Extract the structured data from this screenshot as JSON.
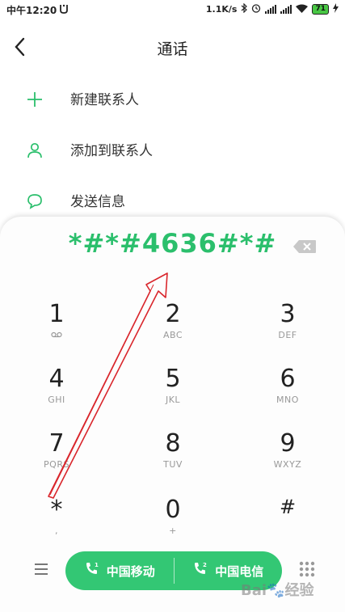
{
  "status_bar": {
    "time": "中午12:20",
    "net_speed": "1.1K/s",
    "battery": "71"
  },
  "header": {
    "title": "通话"
  },
  "menu": [
    {
      "label": "新建联系人",
      "icon": "plus-icon"
    },
    {
      "label": "添加到联系人",
      "icon": "person-icon"
    },
    {
      "label": "发送信息",
      "icon": "message-icon"
    }
  ],
  "dialer": {
    "number": "*#*#4636#*#",
    "keys": [
      {
        "digit": "1",
        "letters": "",
        "sub_icon": "voicemail-icon"
      },
      {
        "digit": "2",
        "letters": "ABC"
      },
      {
        "digit": "3",
        "letters": "DEF"
      },
      {
        "digit": "4",
        "letters": "GHI"
      },
      {
        "digit": "5",
        "letters": "JKL"
      },
      {
        "digit": "6",
        "letters": "MNO"
      },
      {
        "digit": "7",
        "letters": "PQRS"
      },
      {
        "digit": "8",
        "letters": "TUV"
      },
      {
        "digit": "9",
        "letters": "WXYZ"
      },
      {
        "digit": "*",
        "letters": ","
      },
      {
        "digit": "0",
        "letters": "+"
      },
      {
        "digit": "#",
        "letters": ""
      }
    ]
  },
  "call_buttons": [
    {
      "label": "中国移动",
      "sim": "1"
    },
    {
      "label": "中国电信",
      "sim": "2"
    }
  ],
  "watermark": "Bai🐾经验",
  "colors": {
    "accent": "#33c774",
    "number": "#2bbf6c",
    "annotation": "#d9262c"
  }
}
